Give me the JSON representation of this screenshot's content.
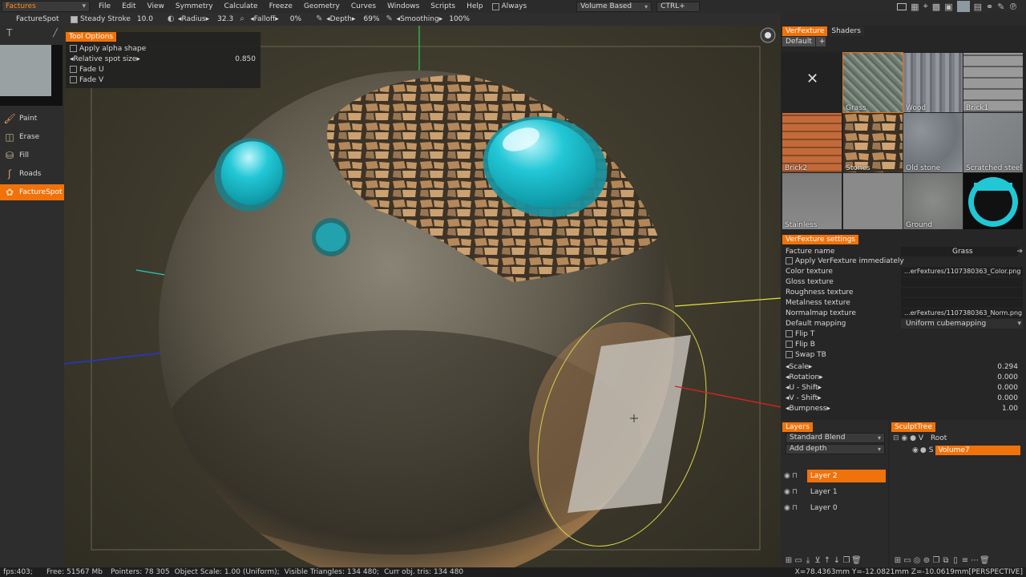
{
  "menubar": {
    "mode": "Factures",
    "items": [
      "File",
      "Edit",
      "View",
      "Symmetry",
      "Calculate",
      "Freeze",
      "Geometry",
      "Curves",
      "Windows",
      "Scripts",
      "Help"
    ],
    "always_label": "Always",
    "volume_mode": "Volume Based",
    "shortcut": "CTRL+"
  },
  "toolbar": {
    "tool_name": "FactureSpot",
    "steady_stroke": "Steady  Stroke",
    "steady_value": "10.0",
    "radius_label": "◂Radius▸",
    "radius_value": "32.3",
    "falloff_label": "◂Falloff▸",
    "falloff_value": "0%",
    "depth_label": "◂Depth▸",
    "depth_value": "69%",
    "smoothing_label": "◂Smoothing▸",
    "smoothing_value": "100%"
  },
  "tools": [
    {
      "label": "Paint",
      "active": false
    },
    {
      "label": "Erase",
      "active": false
    },
    {
      "label": "Fill",
      "active": false
    },
    {
      "label": "Roads",
      "active": false
    },
    {
      "label": "FactureSpot",
      "active": true
    }
  ],
  "tool_options": {
    "title": "Tool  Options",
    "apply_alpha": "Apply  alpha  shape",
    "relative_spot": "◂Relative  spot  size▸",
    "relative_value": "0.850",
    "fade_u": "Fade  U",
    "fade_v": "Fade  V"
  },
  "verfexture": {
    "tab_active": "VerFexture",
    "tab_other": "Shaders",
    "preset_tab": "Default",
    "add": "+",
    "textures": [
      {
        "label": "",
        "kind": "none"
      },
      {
        "label": "Grass",
        "kind": "grass"
      },
      {
        "label": "Wood",
        "kind": "wood"
      },
      {
        "label": "Brick1",
        "kind": "brick1"
      },
      {
        "label": "Brick2",
        "kind": "brick2"
      },
      {
        "label": "Stones",
        "kind": "stones"
      },
      {
        "label": "Old  stone",
        "kind": "oldstone"
      },
      {
        "label": "Scratched  steel",
        "kind": "steel"
      },
      {
        "label": "Stainless",
        "kind": "stainless"
      },
      {
        "label": "",
        "kind": "plain"
      },
      {
        "label": "Ground",
        "kind": "ground"
      },
      {
        "label": "",
        "kind": "drip"
      }
    ]
  },
  "settings": {
    "title": "VerFexture  settings",
    "facture_name_label": "Facture  name",
    "facture_name": "Grass",
    "apply_immediately": "Apply  VerFexture  immediately",
    "color_texture_label": "Color  texture",
    "color_texture": "...erFextures/1107380363_Color.png",
    "gloss_label": "Gloss  texture",
    "roughness_label": "Roughness  texture",
    "metalness_label": "Metalness  texture",
    "normalmap_label": "Normalmap  texture",
    "normalmap": "...erFextures/1107380363_Norm.png",
    "mapping_label": "Default  mapping",
    "mapping": "Uniform  cubemapping",
    "flip_t": "Flip  T",
    "flip_b": "Flip  B",
    "swap_tb": "Swap  TB",
    "params": [
      {
        "label": "◂Scale▸",
        "value": "0.294"
      },
      {
        "label": "◂Rotation▸",
        "value": "0.000"
      },
      {
        "label": "◂U  -  Shift▸",
        "value": "0.000"
      },
      {
        "label": "◂V  -  Shift▸",
        "value": "0.000"
      },
      {
        "label": "◂Bumpness▸",
        "value": "1.00"
      }
    ]
  },
  "layers": {
    "title": "Layers",
    "blend": "Standard  Blend",
    "depth_mode": "Add  depth",
    "items": [
      {
        "label": "Layer  2",
        "active": true
      },
      {
        "label": "Layer  1",
        "active": false
      },
      {
        "label": "Layer  0",
        "active": false
      }
    ]
  },
  "sculpttree": {
    "title": "SculptTree",
    "root_prefix": "V",
    "root": "Root",
    "child_prefix": "S",
    "child": "Volume7"
  },
  "statusbar": {
    "fps": "fps:403;",
    "free": "Free:  51567  Mb",
    "pointers": "Pointers:  78  305",
    "object_scale": "Object  Scale:  1.00  (Uniform);",
    "visible_tris": "Visible  Triangles:  134  480;",
    "curr_tris": "Curr  obj.  tris:  134  480",
    "coords": "X=78.4363mm  Y=-12.0821mm  Z=-10.0619mm",
    "projection": "[PERSPECTIVE]"
  },
  "colors": {
    "accent": "#f0720a",
    "cyan": "#22c7d6"
  }
}
